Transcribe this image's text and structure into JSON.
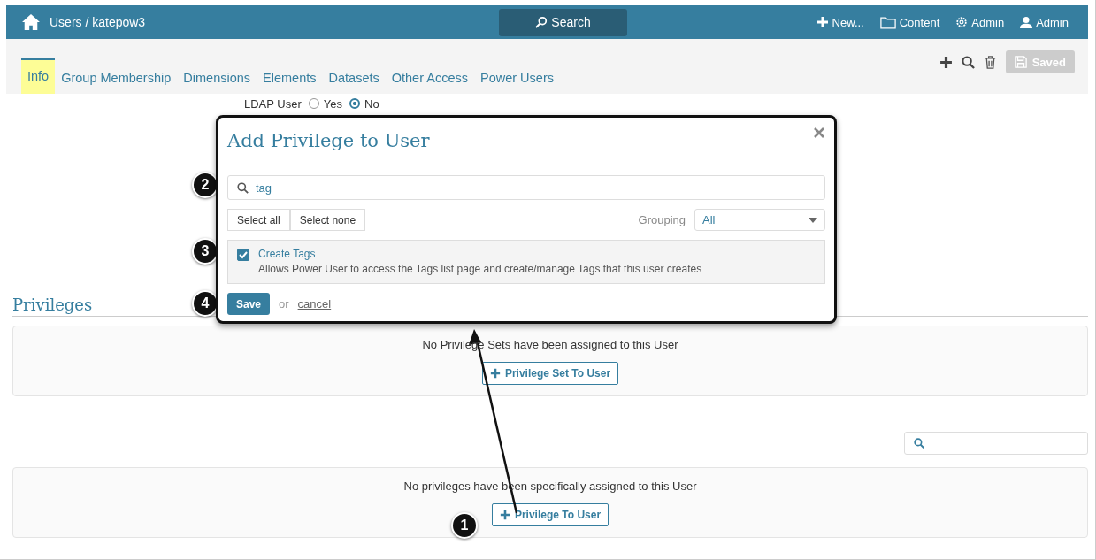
{
  "topbar": {
    "breadcrumb": "Users / katepow3",
    "search": "Search",
    "menu": [
      "New...",
      "Content",
      "Admin",
      "Admin"
    ]
  },
  "tabs": [
    {
      "label": "Info",
      "selected": true
    },
    {
      "label": "Group Membership",
      "selected": false
    },
    {
      "label": "Dimensions",
      "selected": false
    },
    {
      "label": "Elements",
      "selected": false
    },
    {
      "label": "Datasets",
      "selected": false
    },
    {
      "label": "Other Access",
      "selected": false
    },
    {
      "label": "Power Users",
      "selected": false
    }
  ],
  "saved_button": "Saved",
  "ldap": {
    "label": "LDAP User",
    "options": [
      {
        "label": "Yes",
        "selected": false
      },
      {
        "label": "No",
        "selected": true
      }
    ]
  },
  "privileges": {
    "title": "Privileges",
    "sets_message": "No Privilege Sets have been assigned to this User",
    "sets_button": "Privilege Set To User",
    "message": "No privileges have been specifically assigned to this User",
    "button": "Privilege To User"
  },
  "dialog": {
    "title": "Add Privilege to User",
    "search": "tag",
    "select_all": "Select all",
    "select_none": "Select none",
    "grouping_label": "Grouping",
    "grouping": "All",
    "items": [
      {
        "name": "Create Tags",
        "description": "Allows Power User to access the Tags list page and create/manage Tags that this user creates",
        "checked": true
      }
    ],
    "save": "Save",
    "or": "or",
    "cancel": "cancel"
  },
  "callouts": [
    "1",
    "2",
    "3",
    "4"
  ]
}
